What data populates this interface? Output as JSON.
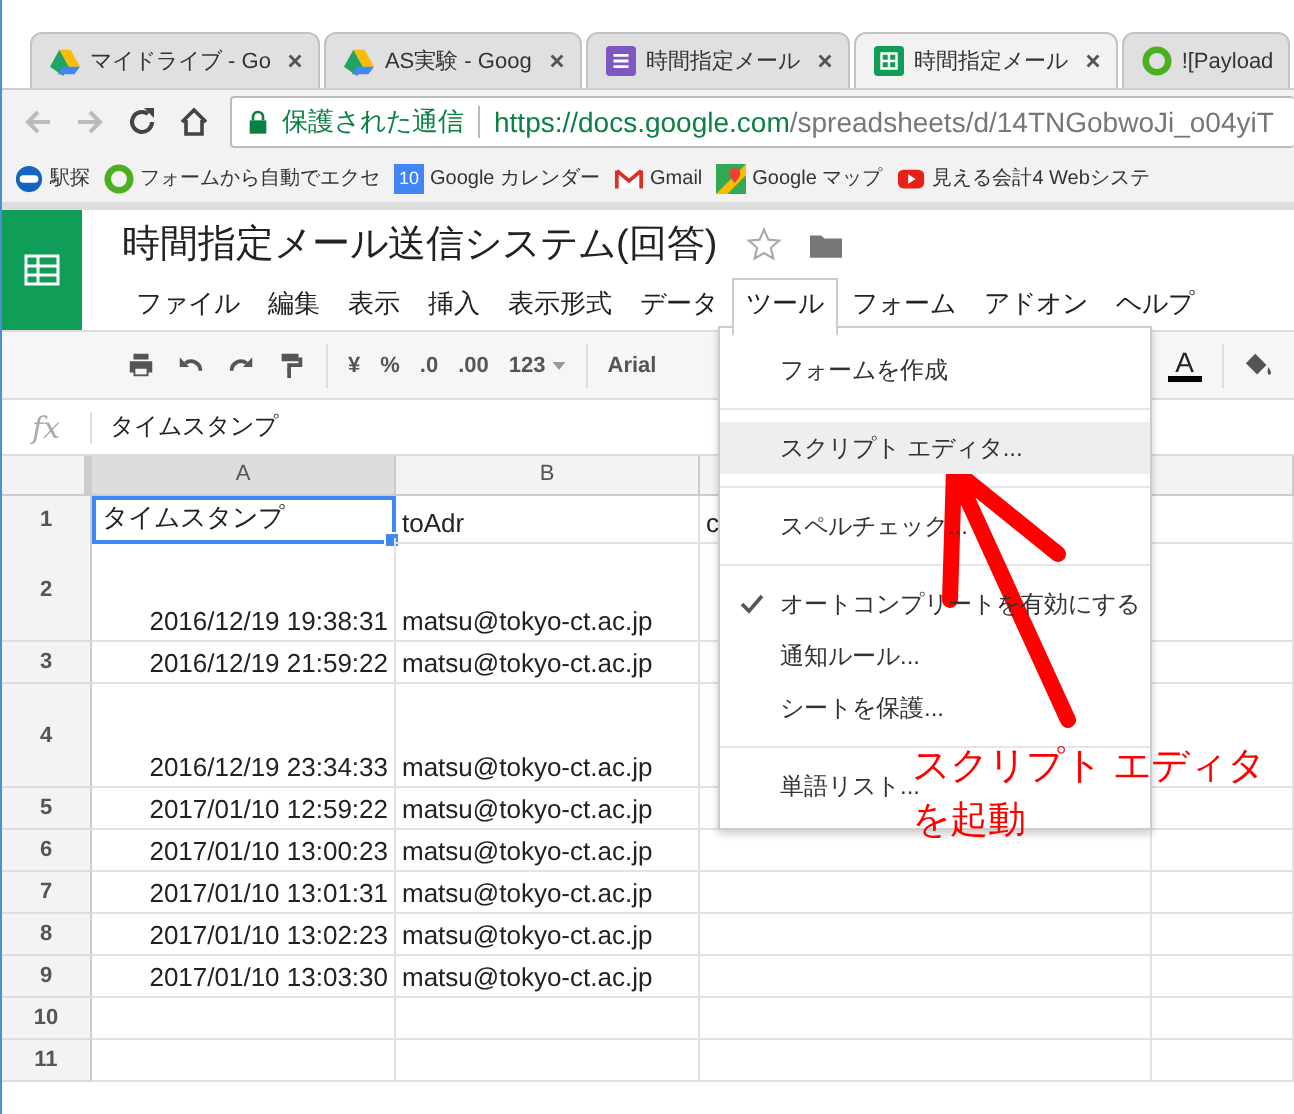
{
  "browser_tabs": [
    {
      "title": "マイドライブ - Go",
      "selected": false
    },
    {
      "title": "AS実験 - Goog",
      "selected": false
    },
    {
      "title": "時間指定メール",
      "selected": false
    },
    {
      "title": "時間指定メール",
      "selected": true
    },
    {
      "title": "![Payload",
      "selected": false
    }
  ],
  "address_bar": {
    "secure_label": "保護された通信",
    "url_host": "https://docs.google.com",
    "url_path": "/spreadsheets/d/14TNGobwoJi_o04yiT"
  },
  "bookmarks": [
    {
      "label": "駅探"
    },
    {
      "label": "フォームから自動でエクセ"
    },
    {
      "label": "Google カレンダー",
      "icon_text": "10"
    },
    {
      "label": "Gmail"
    },
    {
      "label": "Google マップ"
    },
    {
      "label": "見える会計4 Webシステ"
    }
  ],
  "doc": {
    "title": "時間指定メール送信システム(回答)",
    "menus": [
      {
        "label": "ファイル",
        "selected": false
      },
      {
        "label": "編集",
        "selected": false
      },
      {
        "label": "表示",
        "selected": false
      },
      {
        "label": "挿入",
        "selected": false
      },
      {
        "label": "表示形式",
        "selected": false
      },
      {
        "label": "データ",
        "selected": false
      },
      {
        "label": "ツール",
        "selected": true
      },
      {
        "label": "フォーム",
        "selected": false
      },
      {
        "label": "アドオン",
        "selected": false
      },
      {
        "label": "ヘルプ",
        "selected": false
      }
    ]
  },
  "toolbar": {
    "format_buttons": [
      "¥",
      "%",
      ".0",
      ".00"
    ],
    "number_format": "123",
    "font": "Arial",
    "text_color": "A"
  },
  "formula_bar": {
    "fx": "fx",
    "value": "タイムスタンプ"
  },
  "sheet": {
    "columns": [
      {
        "label": "A",
        "selected": true
      },
      {
        "label": "B",
        "selected": false
      }
    ],
    "rows": [
      {
        "number": "1",
        "tall": false,
        "cells": [
          {
            "text": "タイムスタンプ",
            "selected": true
          },
          {
            "text": "toAdr",
            "selected": false
          },
          {
            "text": "c",
            "selected": false
          }
        ]
      },
      {
        "number": "2",
        "tall": true,
        "cells": [
          {
            "text": "2016/12/19 19:38:31",
            "selected": false
          },
          {
            "text": "matsu@tokyo-ct.ac.jp",
            "selected": false
          }
        ]
      },
      {
        "number": "3",
        "tall": false,
        "cells": [
          {
            "text": "2016/12/19 21:59:22",
            "selected": false
          },
          {
            "text": "matsu@tokyo-ct.ac.jp",
            "selected": false
          }
        ]
      },
      {
        "number": "4",
        "tall": true,
        "cells": [
          {
            "text": "2016/12/19 23:34:33",
            "selected": false
          },
          {
            "text": "matsu@tokyo-ct.ac.jp",
            "selected": false
          }
        ]
      },
      {
        "number": "5",
        "tall": false,
        "cells": [
          {
            "text": "2017/01/10 12:59:22",
            "selected": false
          },
          {
            "text": "matsu@tokyo-ct.ac.jp",
            "selected": false
          }
        ]
      },
      {
        "number": "6",
        "tall": false,
        "cells": [
          {
            "text": "2017/01/10 13:00:23",
            "selected": false
          },
          {
            "text": "matsu@tokyo-ct.ac.jp",
            "selected": false
          }
        ]
      },
      {
        "number": "7",
        "tall": false,
        "cells": [
          {
            "text": "2017/01/10 13:01:31",
            "selected": false
          },
          {
            "text": "matsu@tokyo-ct.ac.jp",
            "selected": false
          }
        ]
      },
      {
        "number": "8",
        "tall": false,
        "cells": [
          {
            "text": "2017/01/10 13:02:23",
            "selected": false
          },
          {
            "text": "matsu@tokyo-ct.ac.jp",
            "selected": false
          }
        ]
      },
      {
        "number": "9",
        "tall": false,
        "cells": [
          {
            "text": "2017/01/10 13:03:30",
            "selected": false
          },
          {
            "text": "matsu@tokyo-ct.ac.jp",
            "selected": false
          }
        ]
      },
      {
        "number": "10",
        "tall": false,
        "cells": []
      },
      {
        "number": "11",
        "tall": false,
        "cells": []
      }
    ]
  },
  "menu": {
    "items": [
      {
        "kind": "item",
        "label": "フォームを作成",
        "checked": false,
        "selected": false
      },
      {
        "kind": "separator"
      },
      {
        "kind": "item",
        "label": "スクリプト エディタ...",
        "checked": false,
        "selected": true
      },
      {
        "kind": "separator"
      },
      {
        "kind": "item",
        "label": "スペルチェック...",
        "checked": false,
        "selected": false
      },
      {
        "kind": "separator"
      },
      {
        "kind": "item",
        "label": "オートコンプリートを有効にする",
        "checked": true,
        "selected": false
      },
      {
        "kind": "item",
        "label": "通知ルール...",
        "checked": false,
        "selected": false
      },
      {
        "kind": "item",
        "label": "シートを保護...",
        "checked": false,
        "selected": false
      },
      {
        "kind": "separator"
      },
      {
        "kind": "item",
        "label": "単語リスト...",
        "checked": false,
        "selected": false
      }
    ]
  },
  "annotation": {
    "lines": [
      "スクリプト エディタ",
      "を起動"
    ]
  }
}
